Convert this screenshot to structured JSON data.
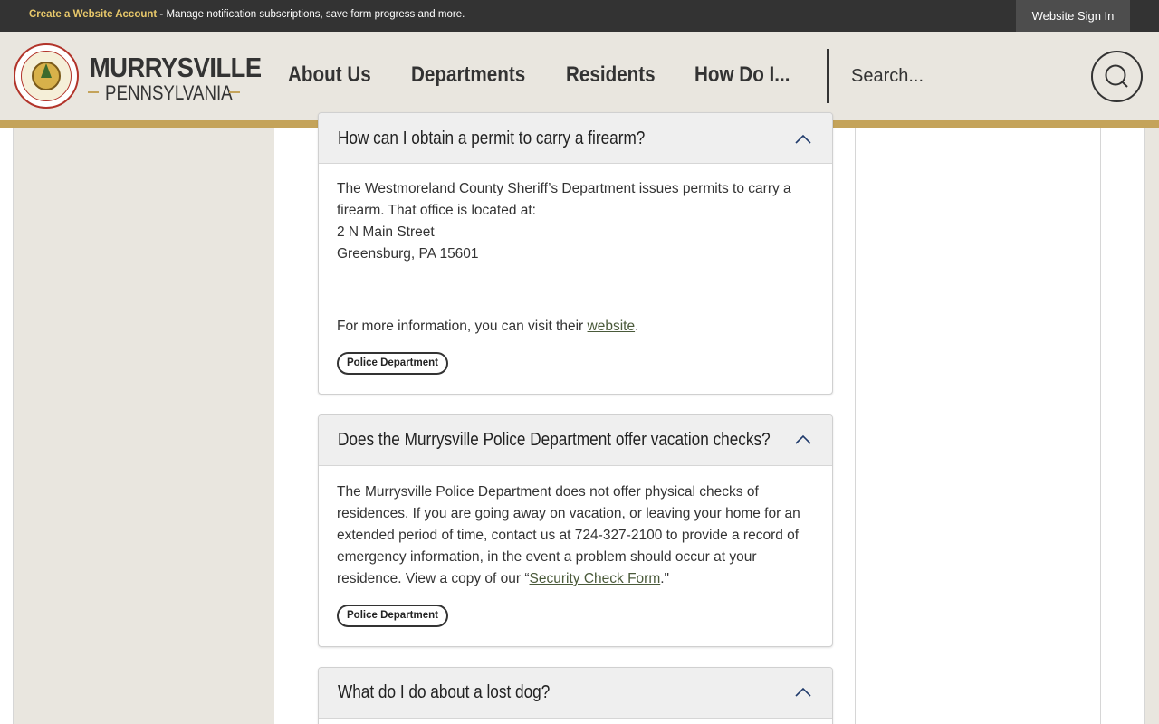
{
  "topbar": {
    "create_account": "Create a Website Account",
    "notice": " - Manage notification subscriptions, save form progress and more.",
    "sign_in": "Website Sign In"
  },
  "brand": {
    "name": "MURRYSVILLE",
    "state": "PENNSYLVANIA"
  },
  "nav": {
    "items": [
      "About Us",
      "Departments",
      "Residents",
      "How Do I..."
    ]
  },
  "search": {
    "placeholder": "Search..."
  },
  "faqs": [
    {
      "question": "How can I obtain a permit to carry a firearm?",
      "para1": "The Westmoreland County Sheriff’s Department issues permits to carry a firearm. That office is located at:",
      "line1": "2 N Main Street",
      "line2": "Greensburg, PA 15601",
      "more_prefix": "For more information, you can visit their ",
      "more_link": "website",
      "more_suffix": ".",
      "tag": "Police Department"
    },
    {
      "question": "Does the Murrysville Police Department offer vacation checks?",
      "body_prefix": "The Murrysville Police Department does not offer physical checks of residences. If you are going away on vacation, or leaving your home for an extended period of time, contact us at 724-327-2100 to provide a record of emergency information, in the event a problem should occur at your residence. View a copy of our “",
      "body_link": "Security Check Form",
      "body_suffix": ".\"",
      "tag": "Police Department"
    },
    {
      "question": "What do I do about a lost dog?"
    }
  ],
  "colors": {
    "topbar": "#333333",
    "accent_gold": "#c4a35a",
    "header_bg": "#e9e6df"
  },
  "icons": {
    "search": "search-icon",
    "collapse": "chevron-up-icon",
    "seal": "municipal-seal-logo"
  }
}
